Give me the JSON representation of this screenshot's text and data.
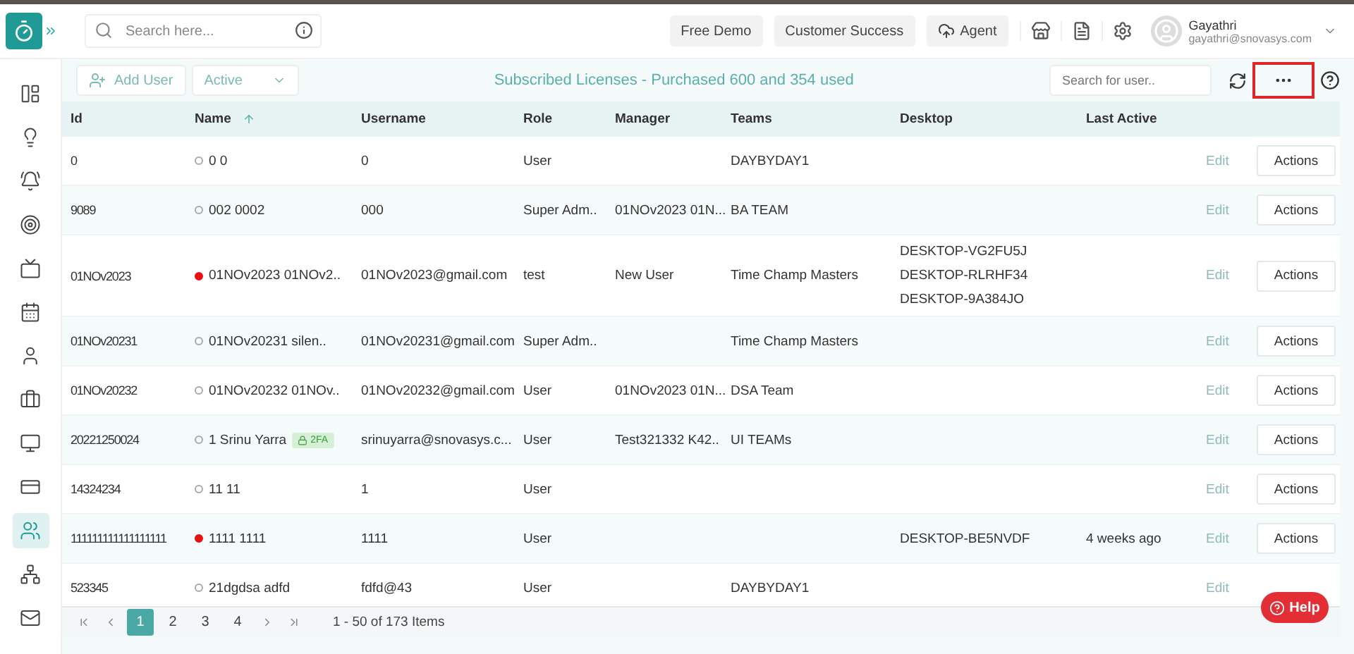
{
  "topbar": {
    "search_placeholder": "Search here...",
    "buttons": [
      "Free Demo",
      "Customer Success",
      "Agent"
    ],
    "user": {
      "name": "Gayathri",
      "email": "gayathri@snovasys.com"
    }
  },
  "sidebar": {
    "items": [
      {
        "selected": false
      },
      {
        "selected": false
      },
      {
        "selected": false
      },
      {
        "selected": false
      },
      {
        "selected": false
      },
      {
        "selected": false
      },
      {
        "selected": false
      },
      {
        "selected": false
      },
      {
        "selected": false
      },
      {
        "selected": false
      },
      {
        "selected": true
      },
      {
        "selected": false
      },
      {
        "selected": false
      }
    ]
  },
  "toolbar": {
    "add_button": "Add User",
    "filter": "Active",
    "title": "Subscribed Licenses - Purchased 600 and 354 used",
    "search_placeholder": "Search for user..",
    "more_highlighted": true
  },
  "table": {
    "columns": [
      "Id",
      "Name",
      "Username",
      "Role",
      "Manager",
      "Teams",
      "Desktop",
      "Last Active"
    ],
    "rows": [
      {
        "id": "0",
        "online": false,
        "name": "0 0",
        "username": "0",
        "role": "User",
        "teams": "DAYBYDAY1",
        "edit": "Edit",
        "action": "Actions"
      },
      {
        "id": "9089",
        "online": false,
        "name": "002 0002",
        "username": "000",
        "role": "Super Adm..",
        "manager": "01NOv2023 01N...",
        "teams": "BA TEAM",
        "edit": "Edit",
        "action": "Actions"
      },
      {
        "id": "01NOv2023",
        "online": true,
        "name": "01NOv2023 01NOv2..",
        "username": "01NOv2023@gmail.com",
        "role": "test",
        "manager": "New User",
        "teams": "Time Champ Masters",
        "desktops": [
          "DESKTOP-VG2FU5J",
          "DESKTOP-RLRHF34",
          "DESKTOP-9A384JO"
        ],
        "edit": "Edit",
        "action": "Actions"
      },
      {
        "id": "01NOv20231",
        "online": false,
        "name": "01NOv20231 silen..",
        "username": "01NOv20231@gmail.com",
        "role": "Super Adm..",
        "teams": "Time Champ Masters",
        "edit": "Edit",
        "action": "Actions"
      },
      {
        "id": "01NOv20232",
        "online": false,
        "name": "01NOv20232 01NOv..",
        "username": "01NOv20232@gmail.com",
        "role": "User",
        "manager": "01NOv2023 01N...",
        "teams": "DSA Team",
        "edit": "Edit",
        "action": "Actions"
      },
      {
        "id": "20221250024",
        "online": false,
        "name": "1 Srinu Yarra",
        "badge": "2FA",
        "username": "srinuyarra@snovasys.c...",
        "role": "User",
        "manager": "Test321332 K42..",
        "teams": "UI TEAMs",
        "edit": "Edit",
        "action": "Actions"
      },
      {
        "id": "14324234",
        "online": false,
        "name": "11 11",
        "username": "1",
        "role": "User",
        "edit": "Edit",
        "action": "Actions"
      },
      {
        "id": "111111111111111111",
        "online": true,
        "name": "1111 1111",
        "username": "1111",
        "role": "User",
        "desktops": [
          "DESKTOP-BE5NVDF"
        ],
        "last_active": "4 weeks ago",
        "edit": "Edit",
        "action": "Actions"
      },
      {
        "id": "523345",
        "online": false,
        "name": "21dgdsa adfd",
        "username": "fdfd@43",
        "role": "User",
        "teams": "DAYBYDAY1",
        "edit": "Edit"
      }
    ]
  },
  "pagination": {
    "pages": [
      {
        "label": "1",
        "selected": true
      },
      {
        "label": "2",
        "selected": false
      },
      {
        "label": "3",
        "selected": false
      },
      {
        "label": "4",
        "selected": false
      }
    ],
    "summary": "1 - 50 of 173 Items"
  },
  "help_button": "Help"
}
